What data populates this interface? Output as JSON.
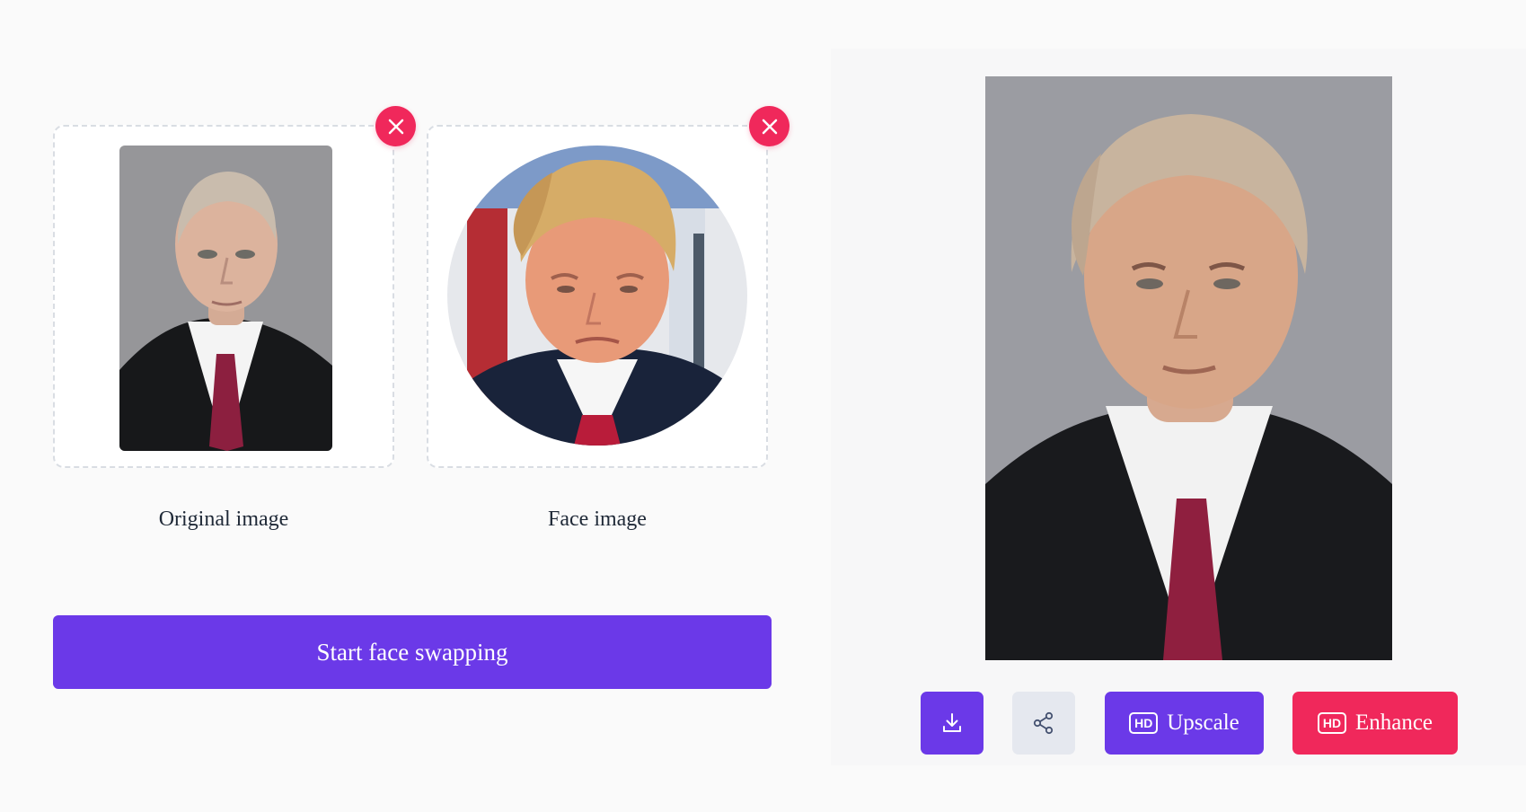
{
  "upload": {
    "original_label": "Original image",
    "face_label": "Face image"
  },
  "start_button_label": "Start face swapping",
  "actions": {
    "upscale_label": "Upscale",
    "enhance_label": "Enhance",
    "hd_badge": "HD"
  },
  "icons": {
    "remove": "close-icon",
    "download": "download-icon",
    "share": "share-icon"
  },
  "colors": {
    "primary": "#6b39e8",
    "danger": "#f0285b",
    "share_bg": "#e5e8ef",
    "upload_border": "#d9dde3",
    "background": "#fafafa"
  }
}
